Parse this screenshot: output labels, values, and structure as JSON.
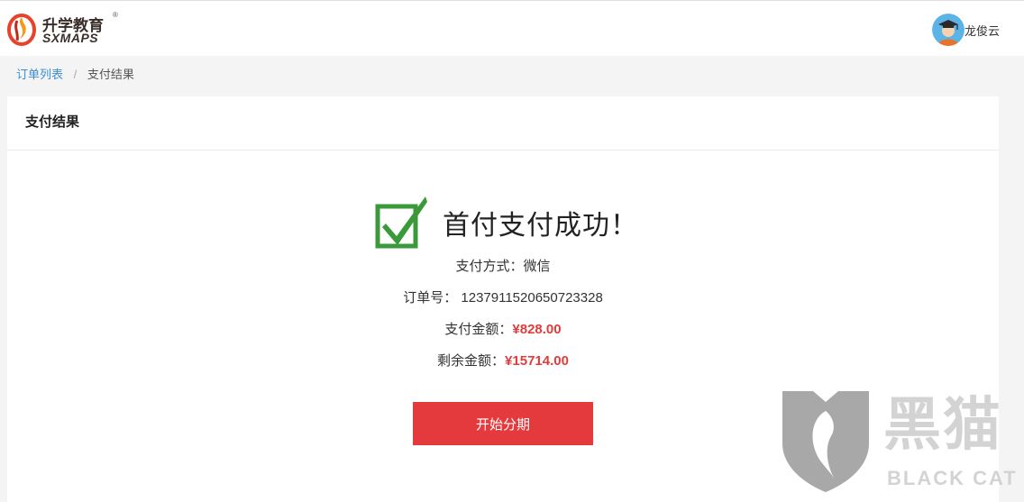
{
  "header": {
    "logo_cn": "升学教育",
    "logo_reg": "®",
    "logo_en": "SXMAPS",
    "user_name": "龙俊云"
  },
  "breadcrumb": {
    "link": "订单列表",
    "separator": "/",
    "current": "支付结果"
  },
  "card": {
    "title": "支付结果",
    "success_message": "首付支付成功！",
    "payment_method_label": "支付方式：",
    "payment_method_value": "微信",
    "order_no_label": "订单号：",
    "order_no_value": "1237911520650723328",
    "paid_amount_label": "支付金额：",
    "paid_amount_value": "¥828.00",
    "remaining_label": "剩余金额：",
    "remaining_value": "¥15714.00",
    "button_label": "开始分期"
  },
  "watermark": {
    "cn": "黑猫",
    "en": "BLACK CAT"
  },
  "colors": {
    "accent_red": "#e53a3d",
    "link_blue": "#3b8ed6",
    "check_green": "#3a9a3a"
  },
  "icons": [
    "logo-flame-icon",
    "avatar-graduate-icon",
    "success-check-icon",
    "blackcat-shield-icon"
  ]
}
